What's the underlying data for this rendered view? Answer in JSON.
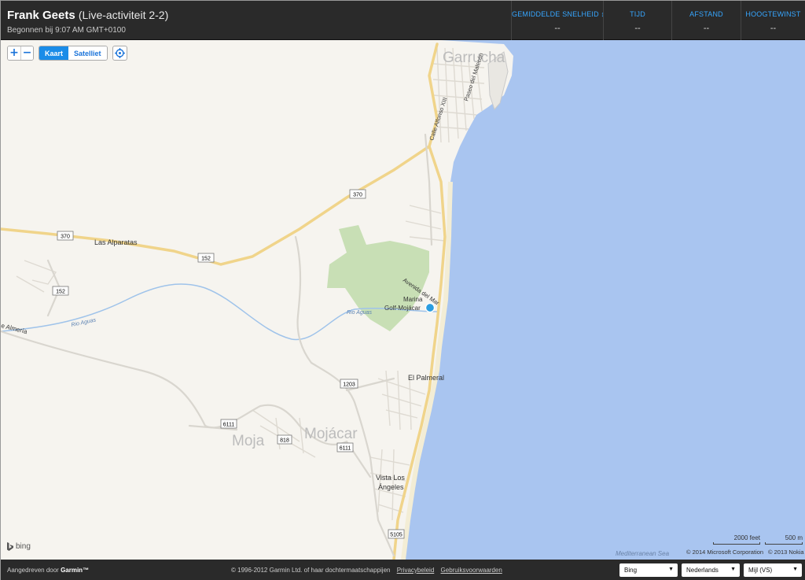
{
  "header": {
    "name": "Frank Geets",
    "activity": "(Live-activiteit 2-2)",
    "started": "Begonnen bij 9:07 AM GMT+0100"
  },
  "stats": [
    {
      "label": "GEMIDDELDE SNELHEID ↕",
      "value": "--"
    },
    {
      "label": "TIJD",
      "value": "--"
    },
    {
      "label": "AFSTAND",
      "value": "--"
    },
    {
      "label": "HOOGTEWINST",
      "value": "--"
    }
  ],
  "controls": {
    "zoom_in": "+",
    "zoom_out": "−",
    "map_type_map": "Kaart",
    "map_type_satellite": "Satelliet"
  },
  "map": {
    "labels": {
      "garrucha": "Garrucha",
      "paseo": "Paseo del Malecón",
      "calle": "Calle Alfonso XIII",
      "las_alparatas": "Las Alparatas",
      "avenida": "Avenida del Mar",
      "marina1": "Marina",
      "marina2": "Golf-Mojácar",
      "rio1": "Rio Aguas",
      "rio2": "Rio Aguas",
      "almeria": "e Almería",
      "el_palmeral": "El Palmeral",
      "mojacar_big": "Mojácar",
      "mojacar_small": "Moja",
      "vista1": "Vista Los",
      "vista2": "Ángeles",
      "sea": "Mediterranean Sea"
    },
    "shields": {
      "r370a": "370",
      "r370b": "370",
      "r152a": "152",
      "r152b": "152",
      "r1203": "1203",
      "r6111a": "6111",
      "r6111b": "6111",
      "r818": "818",
      "r5105": "5105"
    },
    "bing": "bing",
    "scale_feet": "2000 feet",
    "scale_m": "500 m",
    "copyright_ms": "© 2014 Microsoft Corporation",
    "copyright_nokia": "© 2013 Nokia",
    "colors": {
      "sea": "#a9c5f0",
      "land": "#f6f4ef",
      "road": "#f0d48a",
      "park": "#c8dfb5",
      "river": "#9fc3ea",
      "marker": "#2b9de0"
    }
  },
  "footer": {
    "powered_prefix": "Aangedreven door",
    "powered_brand": "Garmin™",
    "copyright": "© 1996-2012 Garmin Ltd. of haar dochtermaatschappijen",
    "privacy": "Privacybeleid",
    "terms": "Gebruiksvoorwaarden",
    "map_provider": "Bing",
    "language": "Nederlands",
    "units": "Mijl (VS)"
  }
}
